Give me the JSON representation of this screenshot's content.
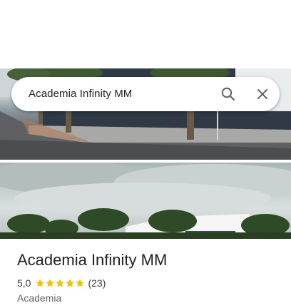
{
  "search": {
    "query": "Academia Infinity MM"
  },
  "place": {
    "name": "Academia Infinity MM",
    "rating": "5,0",
    "rating_value": 5,
    "review_count": "(23)",
    "category": "Academia"
  },
  "colors": {
    "star": "#fbbc04",
    "text_primary": "#202124",
    "text_secondary": "#5f6368"
  },
  "icons": [
    "search-icon",
    "close-icon",
    "star-icon"
  ]
}
